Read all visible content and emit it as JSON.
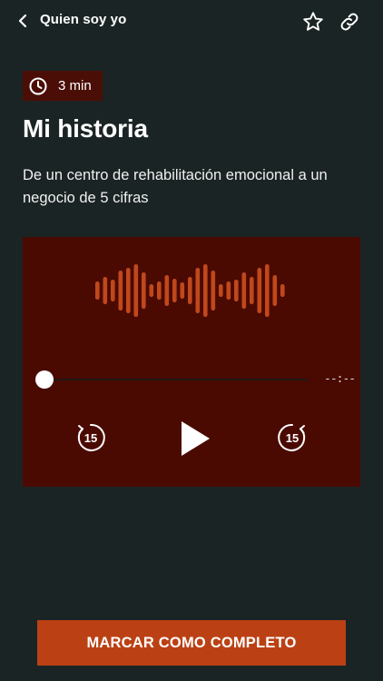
{
  "header": {
    "title": "Quien soy yo",
    "back_icon": "chevron-left-icon",
    "favorite_icon": "star-icon",
    "share_icon": "link-icon"
  },
  "lesson": {
    "duration": "3 min",
    "duration_icon": "clock-icon",
    "title": "Mi historia",
    "subtitle": "De un centro de rehabilitación emocional a un negocio de 5 cifras"
  },
  "player": {
    "progress": 0,
    "time_remaining": "--:--",
    "rewind_seconds": "15",
    "forward_seconds": "15",
    "play_icon": "play-icon",
    "waveform_icon": "waveform-icon"
  },
  "actions": {
    "complete_label": "MARCAR COMO COMPLETO"
  },
  "colors": {
    "background": "#1b2424",
    "player_background": "#4a0a02",
    "badge_background": "#4a0e06",
    "accent": "#bb4114",
    "waveform": "#c0481c"
  }
}
